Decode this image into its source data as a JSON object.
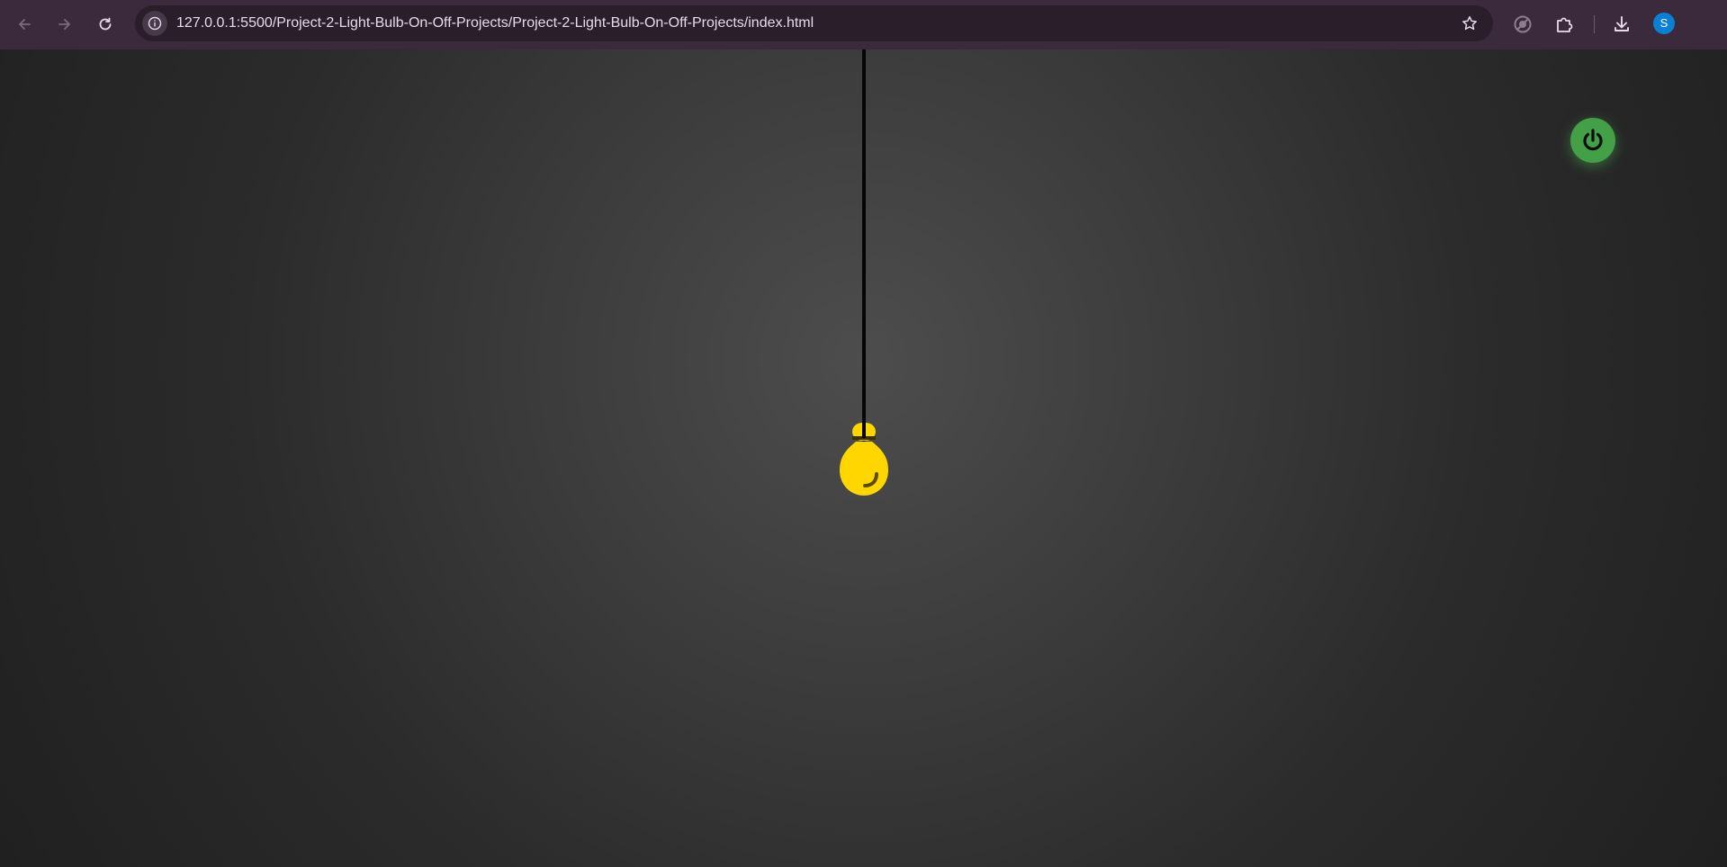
{
  "browser": {
    "url": "127.0.0.1:5500/Project-2-Light-Bulb-On-Off-Projects/Project-2-Light-Bulb-On-Off-Projects/index.html",
    "profile_initial": "S",
    "icons": {
      "back": "arrow-left-icon",
      "forward": "arrow-right-icon",
      "reload": "reload-icon",
      "site_info": "info-icon",
      "bookmark": "star-icon",
      "vpn": "shield-off-icon",
      "extensions": "puzzle-icon",
      "downloads": "download-icon"
    }
  },
  "page": {
    "bulb": {
      "state": "on",
      "color": "#ffd600",
      "icon": "lightbulb-icon"
    },
    "power_button": {
      "icon": "power-icon",
      "color": "#43a047"
    },
    "background_colors": [
      "#4d4d4d",
      "#202020"
    ],
    "cord_color": "#050505"
  }
}
